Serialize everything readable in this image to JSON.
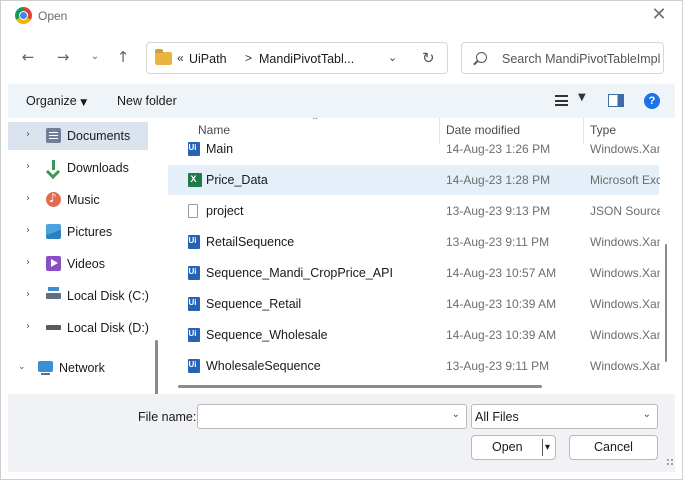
{
  "window": {
    "title": "Open",
    "app_icon": "chrome-icon"
  },
  "nav": {
    "back_icon": "back-arrow-icon",
    "forward_icon": "forward-arrow-icon",
    "recent_icon": "chevron-down-icon",
    "up_icon": "up-arrow-icon"
  },
  "address": {
    "prefix": "«",
    "crumbs": [
      "UiPath",
      "MandiPivotTabl..."
    ],
    "separator": ">"
  },
  "search": {
    "placeholder": "Search MandiPivotTableImpl..."
  },
  "toolbar": {
    "organize": "Organize",
    "new_folder": "New folder"
  },
  "sidebar": {
    "items": [
      {
        "label": "Documents",
        "icon": "documents-icon",
        "selected": true
      },
      {
        "label": "Downloads",
        "icon": "downloads-icon"
      },
      {
        "label": "Music",
        "icon": "music-icon"
      },
      {
        "label": "Pictures",
        "icon": "pictures-icon"
      },
      {
        "label": "Videos",
        "icon": "videos-icon"
      },
      {
        "label": "Local Disk (C:)",
        "icon": "disk-c-icon"
      },
      {
        "label": "Local Disk (D:)",
        "icon": "disk-d-icon"
      },
      {
        "label": "Network",
        "icon": "network-icon",
        "expanded": true
      }
    ]
  },
  "columns": {
    "name": "Name",
    "date": "Date modified",
    "type": "Type"
  },
  "files": [
    {
      "name": "Main",
      "date": "14-Aug-23 1:26 PM",
      "type": "Windows.Xaml",
      "icon": "uipath-icon"
    },
    {
      "name": "Price_Data",
      "date": "14-Aug-23 1:28 PM",
      "type": "Microsoft Excel",
      "icon": "excel-icon",
      "selected": true
    },
    {
      "name": "project",
      "date": "13-Aug-23 9:13 PM",
      "type": "JSON Source",
      "icon": "json-file-icon"
    },
    {
      "name": "RetailSequence",
      "date": "13-Aug-23 9:11 PM",
      "type": "Windows.Xaml",
      "icon": "uipath-icon"
    },
    {
      "name": "Sequence_Mandi_CropPrice_API",
      "date": "14-Aug-23 10:57 AM",
      "type": "Windows.Xaml",
      "icon": "uipath-icon"
    },
    {
      "name": "Sequence_Retail",
      "date": "14-Aug-23 10:39 AM",
      "type": "Windows.Xaml",
      "icon": "uipath-icon"
    },
    {
      "name": "Sequence_Wholesale",
      "date": "14-Aug-23 10:39 AM",
      "type": "Windows.Xaml",
      "icon": "uipath-icon"
    },
    {
      "name": "WholesaleSequence",
      "date": "13-Aug-23 9:11 PM",
      "type": "Windows.Xaml",
      "icon": "uipath-icon"
    }
  ],
  "footer": {
    "file_name_label": "File name:",
    "file_name_value": "",
    "filter_value": "All Files",
    "open_label": "Open",
    "cancel_label": "Cancel"
  }
}
